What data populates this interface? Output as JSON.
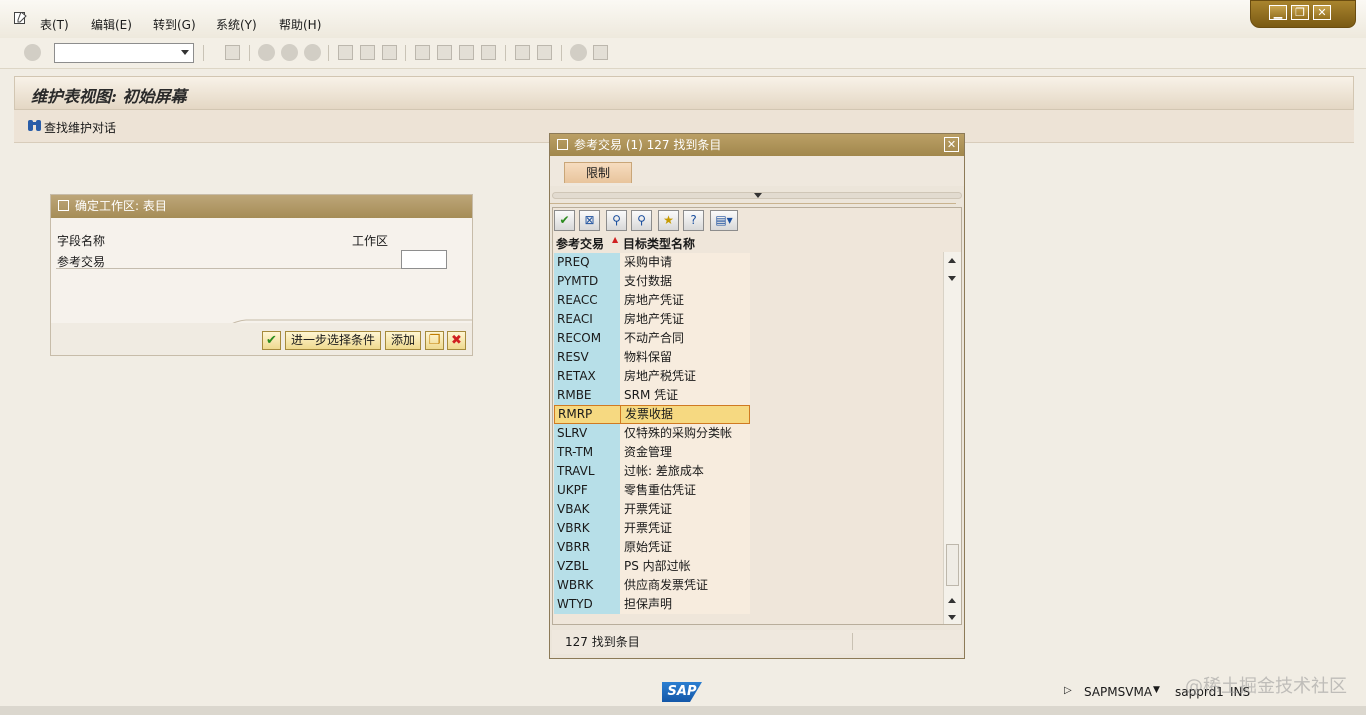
{
  "menu": {
    "items": [
      "表(T)",
      "编辑(E)",
      "转到(G)",
      "系统(Y)",
      "帮助(H)"
    ]
  },
  "window_controls": {
    "minimize": "▁",
    "restore": "❐",
    "close": "✕"
  },
  "page": {
    "title": "维护表视图: 初始屏幕",
    "find_dialog_label": "查找维护对话"
  },
  "work_area_dialog": {
    "title": "确定工作区: 表目",
    "field_name_label": "字段名称",
    "work_area_label": "工作区",
    "reference_transaction_label": "参考交易",
    "work_area_value": "",
    "buttons": {
      "further_selection": "进一步选择条件",
      "add": "添加"
    }
  },
  "f4_dialog": {
    "title": "参考交易 (1)  127 找到条目",
    "tab_restrict": "限制",
    "col_ref_transaction": "参考交易",
    "col_target_type": "目标类型名称",
    "rows": [
      {
        "code": "PREQ",
        "name": "采购申请"
      },
      {
        "code": "PYMTD",
        "name": "支付数据"
      },
      {
        "code": "REACC",
        "name": "房地产凭证"
      },
      {
        "code": "REACI",
        "name": "房地产凭证"
      },
      {
        "code": "RECOM",
        "name": "不动产合同"
      },
      {
        "code": "RESV",
        "name": "物料保留"
      },
      {
        "code": "RETAX",
        "name": "房地产税凭证"
      },
      {
        "code": "RMBE",
        "name": "SRM 凭证"
      },
      {
        "code": "RMRP",
        "name": "发票收据"
      },
      {
        "code": "SLRV",
        "name": "仅特殊的采购分类帐"
      },
      {
        "code": "TR-TM",
        "name": "资金管理"
      },
      {
        "code": "TRAVL",
        "name": "过帐: 差旅成本"
      },
      {
        "code": "UKPF",
        "name": "零售重估凭证"
      },
      {
        "code": "VBAK",
        "name": "开票凭证"
      },
      {
        "code": "VBRK",
        "name": "开票凭证"
      },
      {
        "code": "VBRR",
        "name": "原始凭证"
      },
      {
        "code": "VZBL",
        "name": "PS 内部过帐"
      },
      {
        "code": "WBRK",
        "name": "供应商发票凭证"
      },
      {
        "code": "WTYD",
        "name": "担保声明"
      }
    ],
    "selected_code": "RMRP",
    "status_text": "127 找到条目"
  },
  "statusbar": {
    "program": "SAPMSVMA",
    "server": "sapprd1",
    "mode": "INS",
    "logo": "SAP"
  },
  "watermark": "@稀土掘金技术社区",
  "colors": {
    "header_gold": "#a58c56",
    "key_column": "#b7dfe8",
    "selected_row": "#f6d981"
  }
}
